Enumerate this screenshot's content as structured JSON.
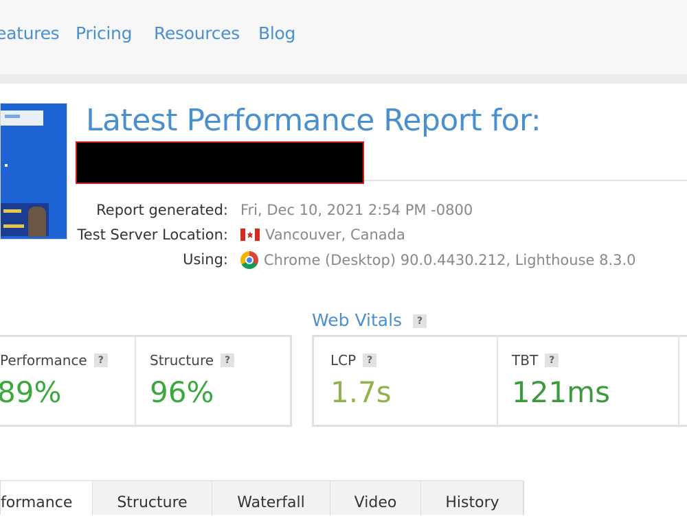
{
  "nav": {
    "items": [
      {
        "label": "eatures"
      },
      {
        "label": "Pricing"
      },
      {
        "label": "Resources"
      },
      {
        "label": "Blog"
      }
    ]
  },
  "report": {
    "title": "Latest Performance Report for:",
    "meta": [
      {
        "label": "Report generated:",
        "value": "Fri, Dec 10, 2021 2:54 PM -0800"
      },
      {
        "label": "Test Server Location:",
        "value": "Vancouver, Canada",
        "icon": "canada-flag-icon"
      },
      {
        "label": "Using:",
        "value": "Chrome (Desktop) 90.0.4430.212, Lighthouse 8.3.0",
        "icon": "chrome-icon"
      }
    ]
  },
  "grades": {
    "performance": {
      "label": "Performance",
      "value": "89%"
    },
    "structure": {
      "label": "Structure",
      "value": "96%"
    }
  },
  "web_vitals": {
    "heading": "Web Vitals",
    "lcp": {
      "label": "LCP",
      "value": "1.7s"
    },
    "tbt": {
      "label": "TBT",
      "value": "121ms"
    }
  },
  "help_glyph": "?",
  "tabs": [
    {
      "label": "formance"
    },
    {
      "label": "Structure"
    },
    {
      "label": "Waterfall"
    },
    {
      "label": "Video"
    },
    {
      "label": "History"
    }
  ],
  "colors": {
    "accent_blue": "#4a90d0",
    "grade_green": "#3ca83c",
    "lcp_green": "#8fb24a",
    "tbt_green": "#3c9a3c",
    "redaction_border": "#d41c1c"
  }
}
